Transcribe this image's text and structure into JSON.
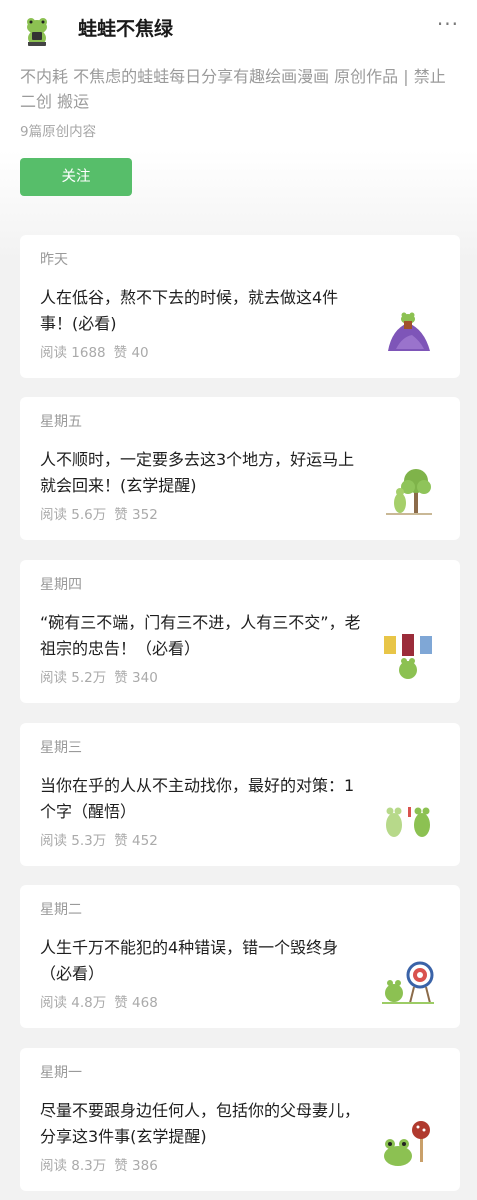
{
  "account": {
    "name": "蛙蛙不焦绿",
    "description": "不内耗 不焦虑的蛙蛙每日分享有趣绘画漫画 原创作品 | 禁止二创 搬运",
    "original_count": "9篇原创内容",
    "follow_label": "关注",
    "more_icon": "more-dots-icon",
    "accent_color": "#57be6a"
  },
  "articles": [
    {
      "day": "昨天",
      "title": "人在低谷，熬不下去的时候，就去做这4件事！(必看)",
      "reads": "阅读 1688",
      "likes": "赞 40",
      "thumb": "frog-purple-blanket-thumbnail"
    },
    {
      "day": "星期五",
      "title": "人不顺时，一定要多去这3个地方，好运马上就会回来！(玄学提醒)",
      "reads": "阅读 5.6万",
      "likes": "赞 352",
      "thumb": "frog-tree-thumbnail"
    },
    {
      "day": "星期四",
      "title": "“碗有三不端，门有三不进，人有三不交”，老祖宗的忠告！（必看）",
      "reads": "阅读 5.2万",
      "likes": "赞 340",
      "thumb": "frog-banners-thumbnail"
    },
    {
      "day": "星期三",
      "title": "当你在乎的人从不主动找你，最好的对策：1个字（醒悟）",
      "reads": "阅读 5.3万",
      "likes": "赞 452",
      "thumb": "two-frogs-thumbnail"
    },
    {
      "day": "星期二",
      "title": "人生千万不能犯的4种错误，错一个毁终身（必看）",
      "reads": "阅读 4.8万",
      "likes": "赞 468",
      "thumb": "frog-target-thumbnail"
    },
    {
      "day": "星期一",
      "title": "尽量不要跟身边任何人，包括你的父母妻儿，分享这3件事(玄学提醒)",
      "reads": "阅读 8.3万",
      "likes": "赞 386",
      "thumb": "frog-mushroom-thumbnail"
    }
  ]
}
